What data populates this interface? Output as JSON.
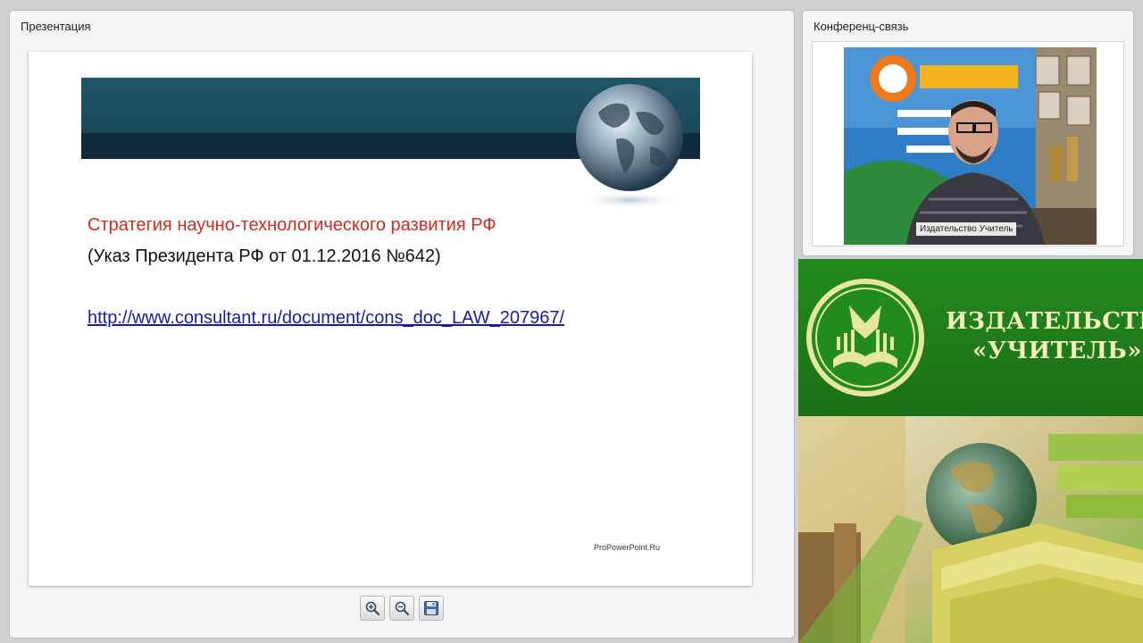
{
  "presentation": {
    "title": "Презентация",
    "slide": {
      "title": "Стратегия научно-технологического развития РФ",
      "subtitle": "(Указ Президента РФ от 01.12.2016 №642)",
      "link": "http://www.consultant.ru/document/cons_doc_LAW_207967/",
      "footer": "ProPowerPoint.Ru"
    },
    "toolbar": {
      "zoom_in_icon": "zoom-in-icon",
      "zoom_out_icon": "zoom-out-icon",
      "save_icon": "save-icon"
    }
  },
  "conference": {
    "title": "Конференц-связь",
    "participant_name": "Издательство Учитель"
  },
  "publisher": {
    "name_line1": "ИЗДАТЕЛЬСТВО",
    "name_line2": "«УЧИТЕЛЬ»"
  },
  "colors": {
    "slide_title": "#d42a1e",
    "slide_link": "#1a1aa6",
    "banner_dark": "#0f2a3c",
    "banner_teal": "#1f5568",
    "publisher_green": "#1f7a1a",
    "publisher_text": "#f4edbb"
  }
}
